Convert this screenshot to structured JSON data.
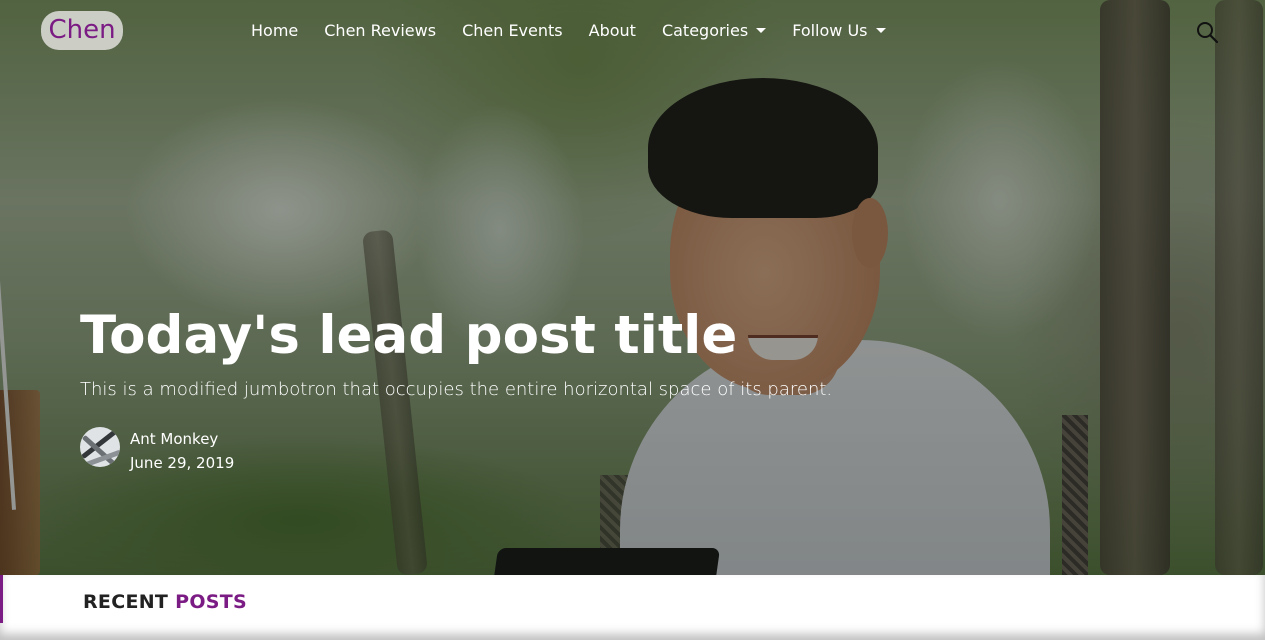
{
  "brand": {
    "name": "Chen"
  },
  "nav": {
    "items": [
      {
        "label": "Home"
      },
      {
        "label": "Chen Reviews"
      },
      {
        "label": "Chen Events"
      },
      {
        "label": "About"
      },
      {
        "label": "Categories"
      },
      {
        "label": "Follow Us"
      }
    ],
    "search_icon": "search-icon"
  },
  "hero": {
    "title": "Today's lead post title",
    "lead": "This is a modified jumbotron that occupies the entire horizontal space of its parent.",
    "author": {
      "name": "Ant Monkey",
      "date": "June 29, 2019"
    }
  },
  "recent": {
    "label_plain": "RECENT",
    "label_accent": "POSTS"
  },
  "colors": {
    "accent": "#7b1b84",
    "text_on_hero": "#ffffff"
  }
}
